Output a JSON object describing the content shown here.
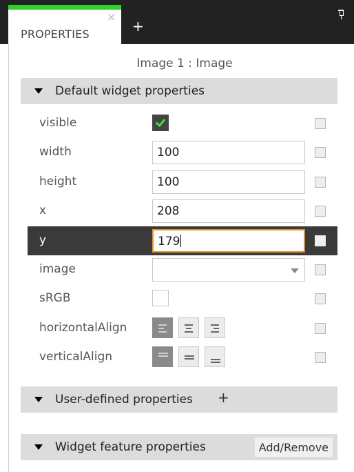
{
  "panel": {
    "tab_label": "PROPERTIES",
    "tab_close": "×",
    "add_tab": "+",
    "object_title": "Image 1 : Image",
    "accent_color": "#2fd22a",
    "focus_color": "#e6902a"
  },
  "sections": {
    "default": {
      "label": "Default widget properties"
    },
    "user_defined": {
      "label": "User-defined properties",
      "add": "+"
    },
    "feature": {
      "label": "Widget feature properties",
      "button": "Add/Remove"
    }
  },
  "props": {
    "visible": {
      "label": "visible",
      "checked": true
    },
    "width": {
      "label": "width",
      "value": "100"
    },
    "height": {
      "label": "height",
      "value": "100"
    },
    "x": {
      "label": "x",
      "value": "208"
    },
    "y": {
      "label": "y",
      "value": "179"
    },
    "image": {
      "label": "image",
      "value": ""
    },
    "srgb": {
      "label": "sRGB",
      "checked": false
    },
    "horizontal_align": {
      "label": "horizontalAlign",
      "options": [
        "left-align-icon",
        "center-align-icon",
        "right-align-icon"
      ],
      "selected": "left"
    },
    "vertical_align": {
      "label": "verticalAlign",
      "options": [
        "top-align-icon",
        "middle-align-icon",
        "bottom-align-icon"
      ],
      "selected": "top"
    }
  }
}
